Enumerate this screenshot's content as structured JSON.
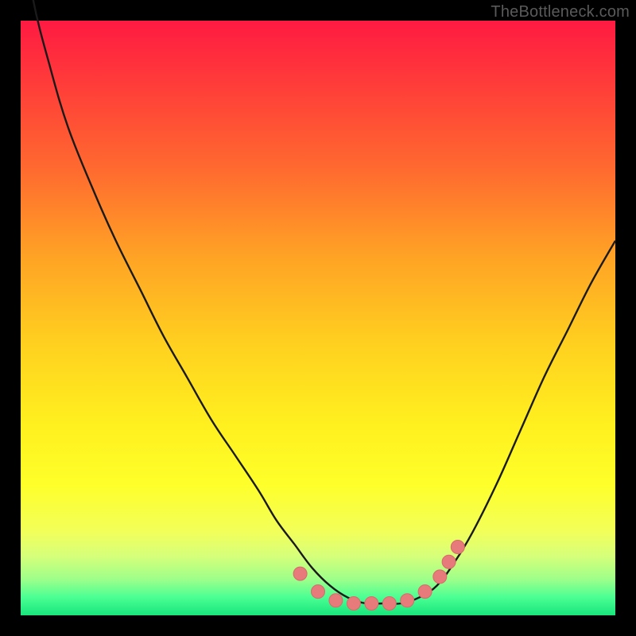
{
  "watermark": "TheBottleneck.com",
  "colors": {
    "frame": "#000000",
    "curve_stroke": "#1a1a1a",
    "marker_fill": "#e77a7a",
    "marker_stroke": "#d96a6a"
  },
  "chart_data": {
    "type": "line",
    "title": "",
    "xlabel": "",
    "ylabel": "",
    "xlim": [
      0,
      100
    ],
    "ylim": [
      0,
      100
    ],
    "grid": false,
    "legend": false,
    "series": [
      {
        "name": "bottleneck-curve",
        "x": [
          0,
          2,
          5,
          8,
          12,
          16,
          20,
          24,
          28,
          32,
          36,
          40,
          43,
          46,
          49,
          52,
          55,
          58,
          61,
          64,
          67,
          70,
          73,
          76,
          80,
          84,
          88,
          92,
          96,
          100
        ],
        "y": [
          118,
          104,
          92,
          82,
          72,
          63,
          55,
          47,
          40,
          33,
          27,
          21,
          16,
          12,
          8,
          5,
          3,
          2,
          2,
          2,
          3,
          5,
          9,
          14,
          22,
          31,
          40,
          48,
          56,
          63
        ]
      }
    ],
    "markers": [
      {
        "x": 47,
        "y": 7
      },
      {
        "x": 50,
        "y": 4
      },
      {
        "x": 53,
        "y": 2.5
      },
      {
        "x": 56,
        "y": 2
      },
      {
        "x": 59,
        "y": 2
      },
      {
        "x": 62,
        "y": 2
      },
      {
        "x": 65,
        "y": 2.5
      },
      {
        "x": 68,
        "y": 4
      },
      {
        "x": 70.5,
        "y": 6.5
      },
      {
        "x": 72,
        "y": 9
      },
      {
        "x": 73.5,
        "y": 11.5
      }
    ]
  }
}
